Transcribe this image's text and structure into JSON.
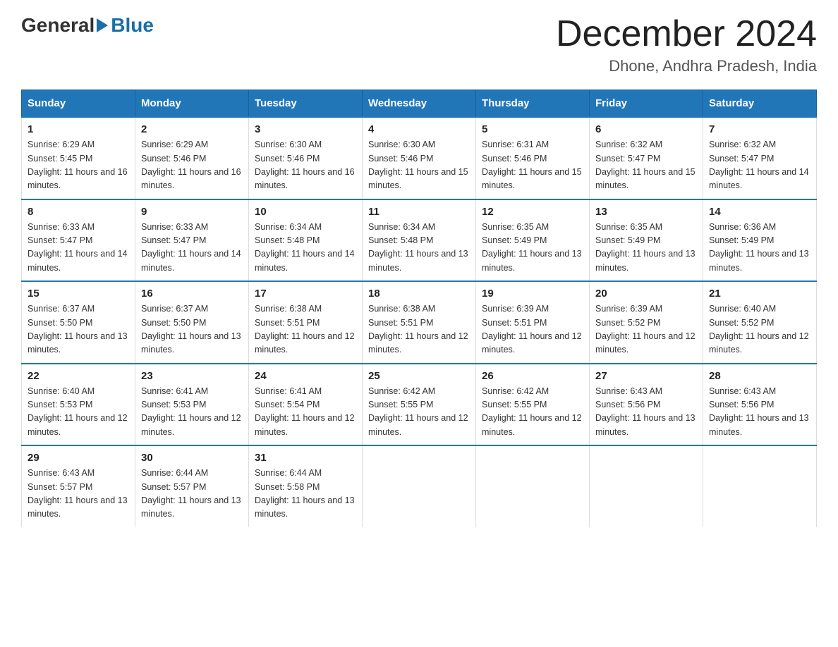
{
  "logo": {
    "general": "General",
    "blue": "Blue",
    "arrow_color": "#1a6fa8"
  },
  "title": "December 2024",
  "location": "Dhone, Andhra Pradesh, India",
  "header_color": "#2176b8",
  "days_of_week": [
    "Sunday",
    "Monday",
    "Tuesday",
    "Wednesday",
    "Thursday",
    "Friday",
    "Saturday"
  ],
  "weeks": [
    [
      {
        "day": "1",
        "sunrise": "6:29 AM",
        "sunset": "5:45 PM",
        "daylight": "11 hours and 16 minutes."
      },
      {
        "day": "2",
        "sunrise": "6:29 AM",
        "sunset": "5:46 PM",
        "daylight": "11 hours and 16 minutes."
      },
      {
        "day": "3",
        "sunrise": "6:30 AM",
        "sunset": "5:46 PM",
        "daylight": "11 hours and 16 minutes."
      },
      {
        "day": "4",
        "sunrise": "6:30 AM",
        "sunset": "5:46 PM",
        "daylight": "11 hours and 15 minutes."
      },
      {
        "day": "5",
        "sunrise": "6:31 AM",
        "sunset": "5:46 PM",
        "daylight": "11 hours and 15 minutes."
      },
      {
        "day": "6",
        "sunrise": "6:32 AM",
        "sunset": "5:47 PM",
        "daylight": "11 hours and 15 minutes."
      },
      {
        "day": "7",
        "sunrise": "6:32 AM",
        "sunset": "5:47 PM",
        "daylight": "11 hours and 14 minutes."
      }
    ],
    [
      {
        "day": "8",
        "sunrise": "6:33 AM",
        "sunset": "5:47 PM",
        "daylight": "11 hours and 14 minutes."
      },
      {
        "day": "9",
        "sunrise": "6:33 AM",
        "sunset": "5:47 PM",
        "daylight": "11 hours and 14 minutes."
      },
      {
        "day": "10",
        "sunrise": "6:34 AM",
        "sunset": "5:48 PM",
        "daylight": "11 hours and 14 minutes."
      },
      {
        "day": "11",
        "sunrise": "6:34 AM",
        "sunset": "5:48 PM",
        "daylight": "11 hours and 13 minutes."
      },
      {
        "day": "12",
        "sunrise": "6:35 AM",
        "sunset": "5:49 PM",
        "daylight": "11 hours and 13 minutes."
      },
      {
        "day": "13",
        "sunrise": "6:35 AM",
        "sunset": "5:49 PM",
        "daylight": "11 hours and 13 minutes."
      },
      {
        "day": "14",
        "sunrise": "6:36 AM",
        "sunset": "5:49 PM",
        "daylight": "11 hours and 13 minutes."
      }
    ],
    [
      {
        "day": "15",
        "sunrise": "6:37 AM",
        "sunset": "5:50 PM",
        "daylight": "11 hours and 13 minutes."
      },
      {
        "day": "16",
        "sunrise": "6:37 AM",
        "sunset": "5:50 PM",
        "daylight": "11 hours and 13 minutes."
      },
      {
        "day": "17",
        "sunrise": "6:38 AM",
        "sunset": "5:51 PM",
        "daylight": "11 hours and 12 minutes."
      },
      {
        "day": "18",
        "sunrise": "6:38 AM",
        "sunset": "5:51 PM",
        "daylight": "11 hours and 12 minutes."
      },
      {
        "day": "19",
        "sunrise": "6:39 AM",
        "sunset": "5:51 PM",
        "daylight": "11 hours and 12 minutes."
      },
      {
        "day": "20",
        "sunrise": "6:39 AM",
        "sunset": "5:52 PM",
        "daylight": "11 hours and 12 minutes."
      },
      {
        "day": "21",
        "sunrise": "6:40 AM",
        "sunset": "5:52 PM",
        "daylight": "11 hours and 12 minutes."
      }
    ],
    [
      {
        "day": "22",
        "sunrise": "6:40 AM",
        "sunset": "5:53 PM",
        "daylight": "11 hours and 12 minutes."
      },
      {
        "day": "23",
        "sunrise": "6:41 AM",
        "sunset": "5:53 PM",
        "daylight": "11 hours and 12 minutes."
      },
      {
        "day": "24",
        "sunrise": "6:41 AM",
        "sunset": "5:54 PM",
        "daylight": "11 hours and 12 minutes."
      },
      {
        "day": "25",
        "sunrise": "6:42 AM",
        "sunset": "5:55 PM",
        "daylight": "11 hours and 12 minutes."
      },
      {
        "day": "26",
        "sunrise": "6:42 AM",
        "sunset": "5:55 PM",
        "daylight": "11 hours and 12 minutes."
      },
      {
        "day": "27",
        "sunrise": "6:43 AM",
        "sunset": "5:56 PM",
        "daylight": "11 hours and 13 minutes."
      },
      {
        "day": "28",
        "sunrise": "6:43 AM",
        "sunset": "5:56 PM",
        "daylight": "11 hours and 13 minutes."
      }
    ],
    [
      {
        "day": "29",
        "sunrise": "6:43 AM",
        "sunset": "5:57 PM",
        "daylight": "11 hours and 13 minutes."
      },
      {
        "day": "30",
        "sunrise": "6:44 AM",
        "sunset": "5:57 PM",
        "daylight": "11 hours and 13 minutes."
      },
      {
        "day": "31",
        "sunrise": "6:44 AM",
        "sunset": "5:58 PM",
        "daylight": "11 hours and 13 minutes."
      },
      null,
      null,
      null,
      null
    ]
  ]
}
